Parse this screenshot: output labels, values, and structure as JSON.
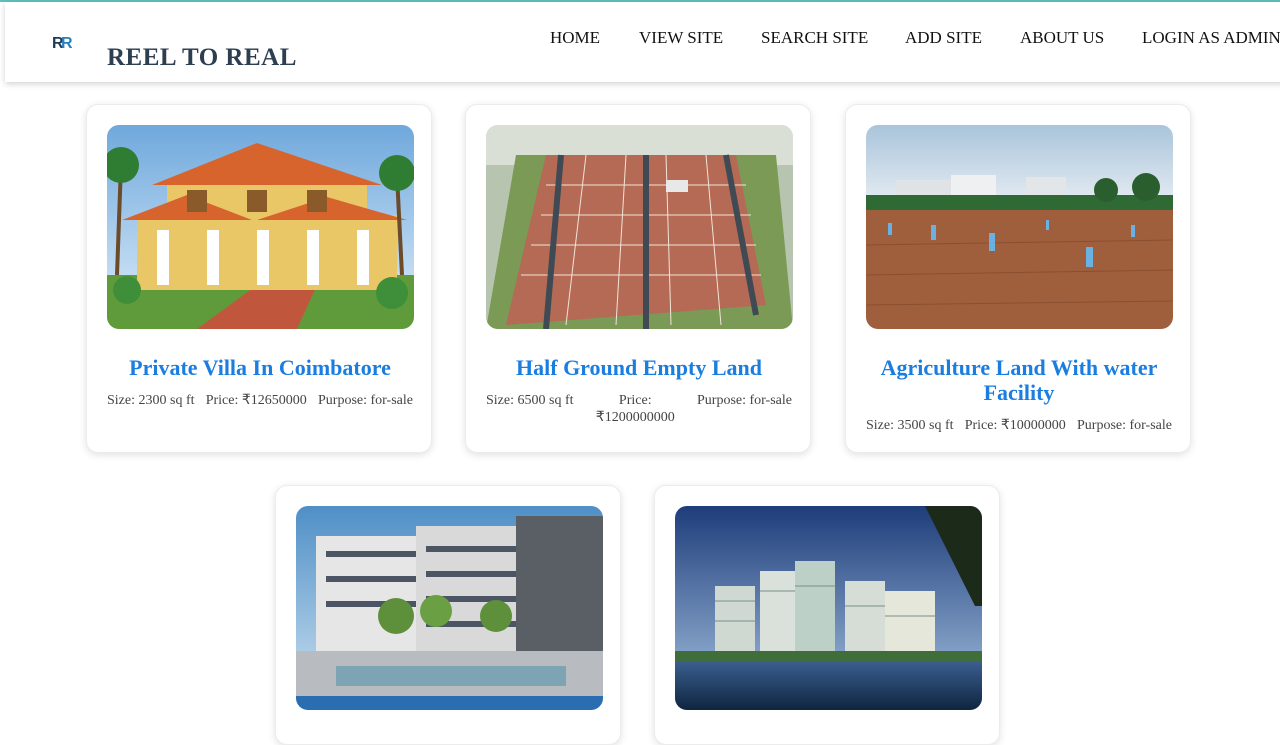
{
  "header": {
    "brand": "REEL TO REAL",
    "logo_text": "RR"
  },
  "nav": [
    {
      "label": "HOME"
    },
    {
      "label": "VIEW SITE"
    },
    {
      "label": "SEARCH SITE"
    },
    {
      "label": "ADD SITE"
    },
    {
      "label": "ABOUT US"
    },
    {
      "label": "LOGIN AS ADMIN"
    }
  ],
  "listings": [
    {
      "title": "Private Villa In Coimbatore",
      "size": "Size: 2300 sq ft",
      "price": "Price: ₹12650000",
      "purpose": "Purpose: for-sale",
      "image": "villa-house-photo"
    },
    {
      "title": "Half Ground Empty Land",
      "size": "Size: 6500 sq ft",
      "price": "Price: ₹1200000000",
      "purpose": "Purpose: for-sale",
      "image": "land-plots-aerial-photo"
    },
    {
      "title": "Agriculture Land With water Facility",
      "size": "Size: 3500 sq ft",
      "price": "Price: ₹10000000",
      "purpose": "Purpose: for-sale",
      "image": "agriculture-field-photo"
    },
    {
      "title": "",
      "image": "apartment-complex-photo"
    },
    {
      "title": "",
      "image": "riverside-towers-photo"
    }
  ],
  "colors": {
    "title_blue": "#1a7de0",
    "brand_dark": "#2c3e50",
    "top_accent": "#5bc0be"
  }
}
